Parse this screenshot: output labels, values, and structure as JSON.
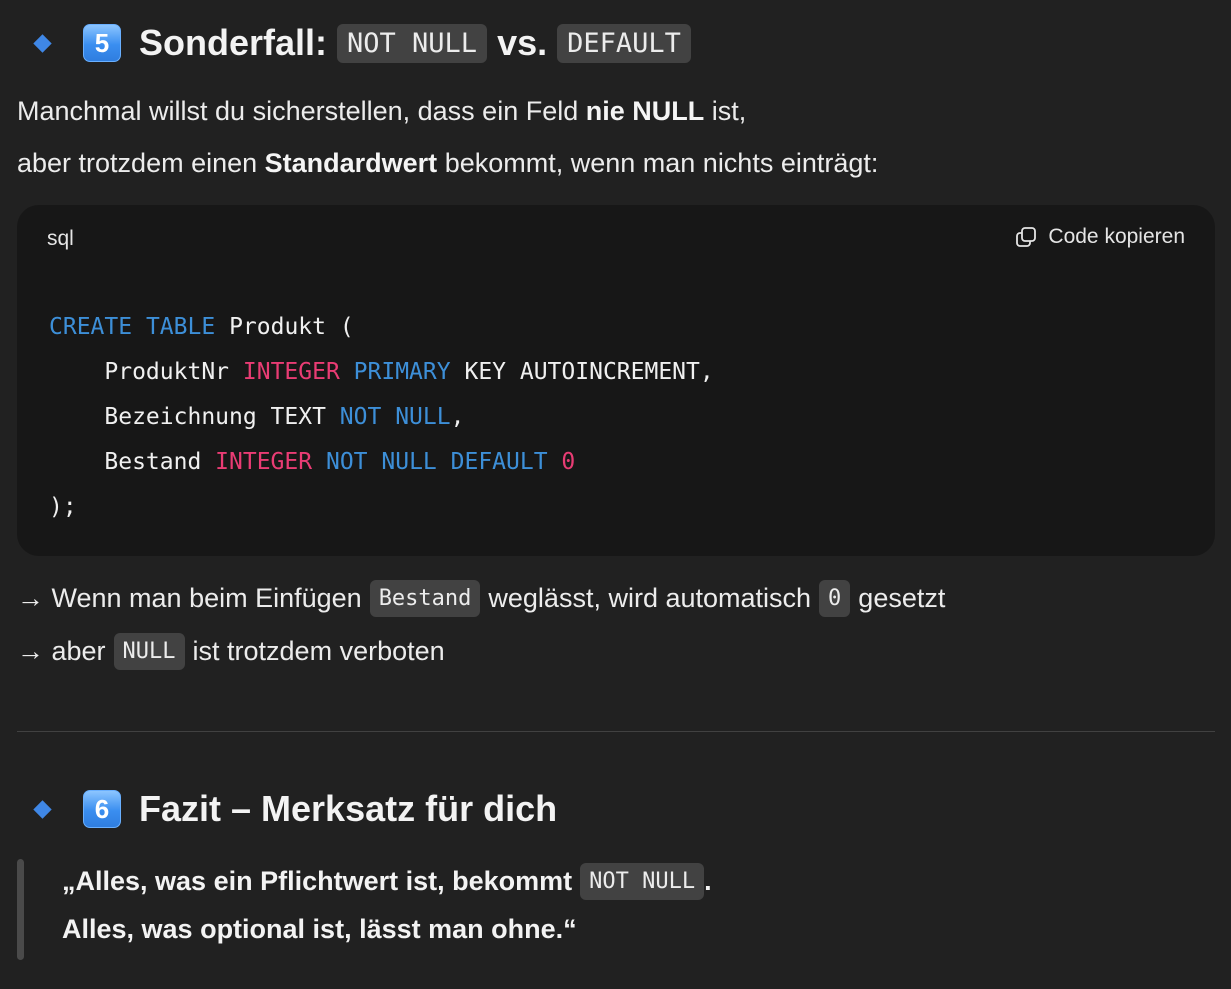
{
  "section5": {
    "number": "5",
    "title_prefix": "Sonderfall:",
    "code_a": "NOT NULL",
    "title_mid": "vs.",
    "code_b": "DEFAULT"
  },
  "intro": {
    "line1_before": "Manchmal willst du sicherstellen, dass ein Feld ",
    "line1_bold": "nie NULL",
    "line1_after": " ist,",
    "line2_before": "aber trotzdem einen ",
    "line2_bold": "Standardwert",
    "line2_after": " bekommt, wenn man nichts einträgt:"
  },
  "codeblock": {
    "language": "sql",
    "copy_label": "Code kopieren",
    "line1": [
      "CREATE",
      "TABLE",
      "Produkt ("
    ],
    "line2": [
      "    ProduktNr ",
      "INTEGER",
      "PRIMARY",
      "KEY AUTOINCREMENT,"
    ],
    "line3": [
      "    Bezeichnung TEXT ",
      "NOT",
      "NULL",
      ","
    ],
    "line4": [
      "    Bestand ",
      "INTEGER",
      "NOT",
      "NULL",
      "DEFAULT",
      "0"
    ],
    "line5": ");"
  },
  "notes": {
    "n1_before": "→ Wenn man beim Einfügen",
    "n1_code": "Bestand",
    "n1_mid": "weglässt, wird automatisch",
    "n1_code2": "0",
    "n1_after": "gesetzt",
    "n2_before": "→ aber",
    "n2_code": "NULL",
    "n2_after": "ist trotzdem verboten"
  },
  "section6": {
    "number": "6",
    "title": "Fazit – Merksatz für dich"
  },
  "quote": {
    "line1_before": "„Alles, was ein Pflichtwert ist, bekommt",
    "line1_code": "NOT NULL",
    "line1_after": ".",
    "line2": "Alles, was optional ist, lässt man ohne.“"
  },
  "colors": {
    "keyword": "#3d8fd8",
    "type": "#e93c74",
    "keycap": "#3a8ef0"
  }
}
